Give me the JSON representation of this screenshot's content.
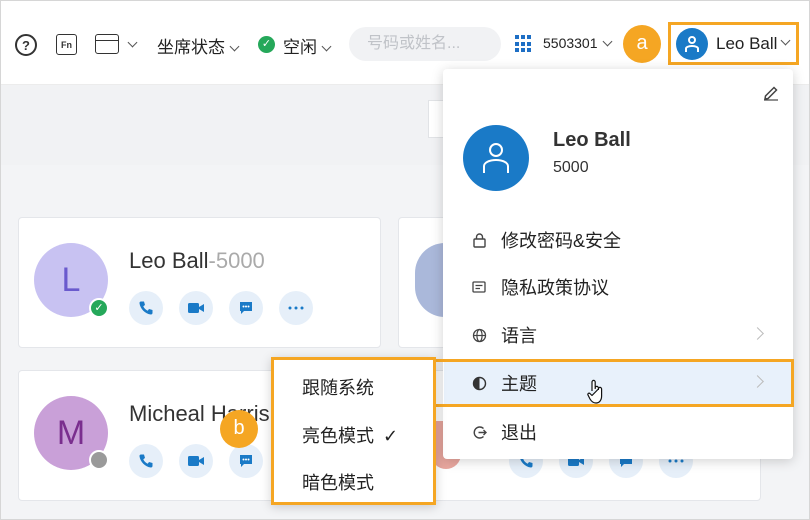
{
  "topbar": {
    "help_icon": "help-circle-icon",
    "fn_label": "Fn",
    "agent_status_label": "坐席状态",
    "presence_label": "空闲",
    "search_placeholder": "号码或姓名...",
    "extension": "5503301",
    "user_name": "Leo Ball"
  },
  "badges": {
    "a": "a",
    "b": "b"
  },
  "contacts": [
    {
      "initial": "L",
      "name": "Leo Ball",
      "ext": "-5000",
      "avatar_bg": "#c8c2f2",
      "avatar_fg": "#6a5acd",
      "status": "online"
    },
    {
      "initial": "M",
      "name": "Micheal Harris",
      "ext": "",
      "avatar_bg": "#c9a0d8",
      "avatar_fg": "#7a2e8e",
      "status": "offline"
    }
  ],
  "profile": {
    "name": "Leo Ball",
    "ext": "5000",
    "menu": [
      {
        "label": "修改密码&安全",
        "icon": "lock-icon",
        "arrow": false
      },
      {
        "label": "隐私政策协议",
        "icon": "id-card-icon",
        "arrow": false
      },
      {
        "label": "语言",
        "icon": "globe-icon",
        "arrow": true
      },
      {
        "label": "主题",
        "icon": "contrast-icon",
        "arrow": true
      },
      {
        "label": "退出",
        "icon": "logout-icon",
        "arrow": false
      }
    ]
  },
  "theme_menu": {
    "items": [
      "跟随系统",
      "亮色模式",
      "暗色模式"
    ],
    "selected": "亮色模式",
    "check": "✓"
  },
  "colors": {
    "accent": "#1a7ac7",
    "highlight": "#f5a623",
    "ok": "#25a85a"
  }
}
